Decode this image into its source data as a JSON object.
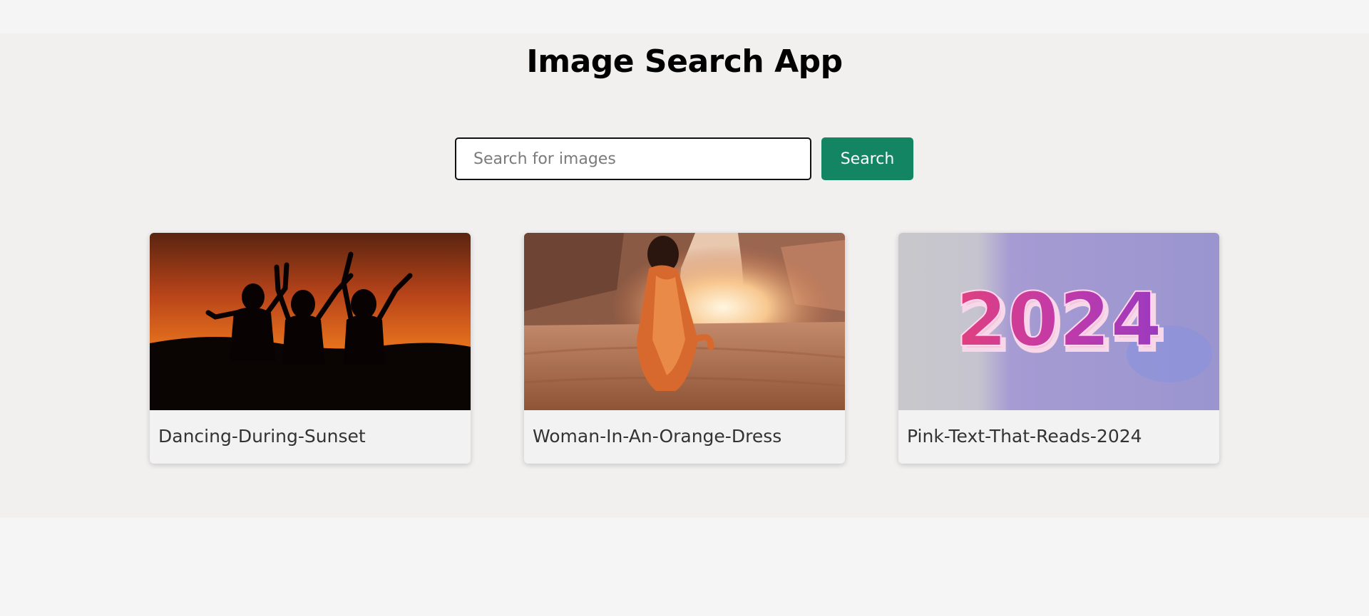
{
  "app": {
    "title": "Image Search App"
  },
  "search": {
    "placeholder": "Search for images",
    "value": "",
    "button_label": "Search"
  },
  "results": [
    {
      "caption": "Dancing-During-Sunset"
    },
    {
      "caption": "Woman-In-An-Orange-Dress"
    },
    {
      "caption": "Pink-Text-That-Reads-2024",
      "image_text": "2024"
    }
  ],
  "colors": {
    "page_background": "#f5f5f5",
    "app_background": "#f2f0ef",
    "accent": "#138562"
  }
}
